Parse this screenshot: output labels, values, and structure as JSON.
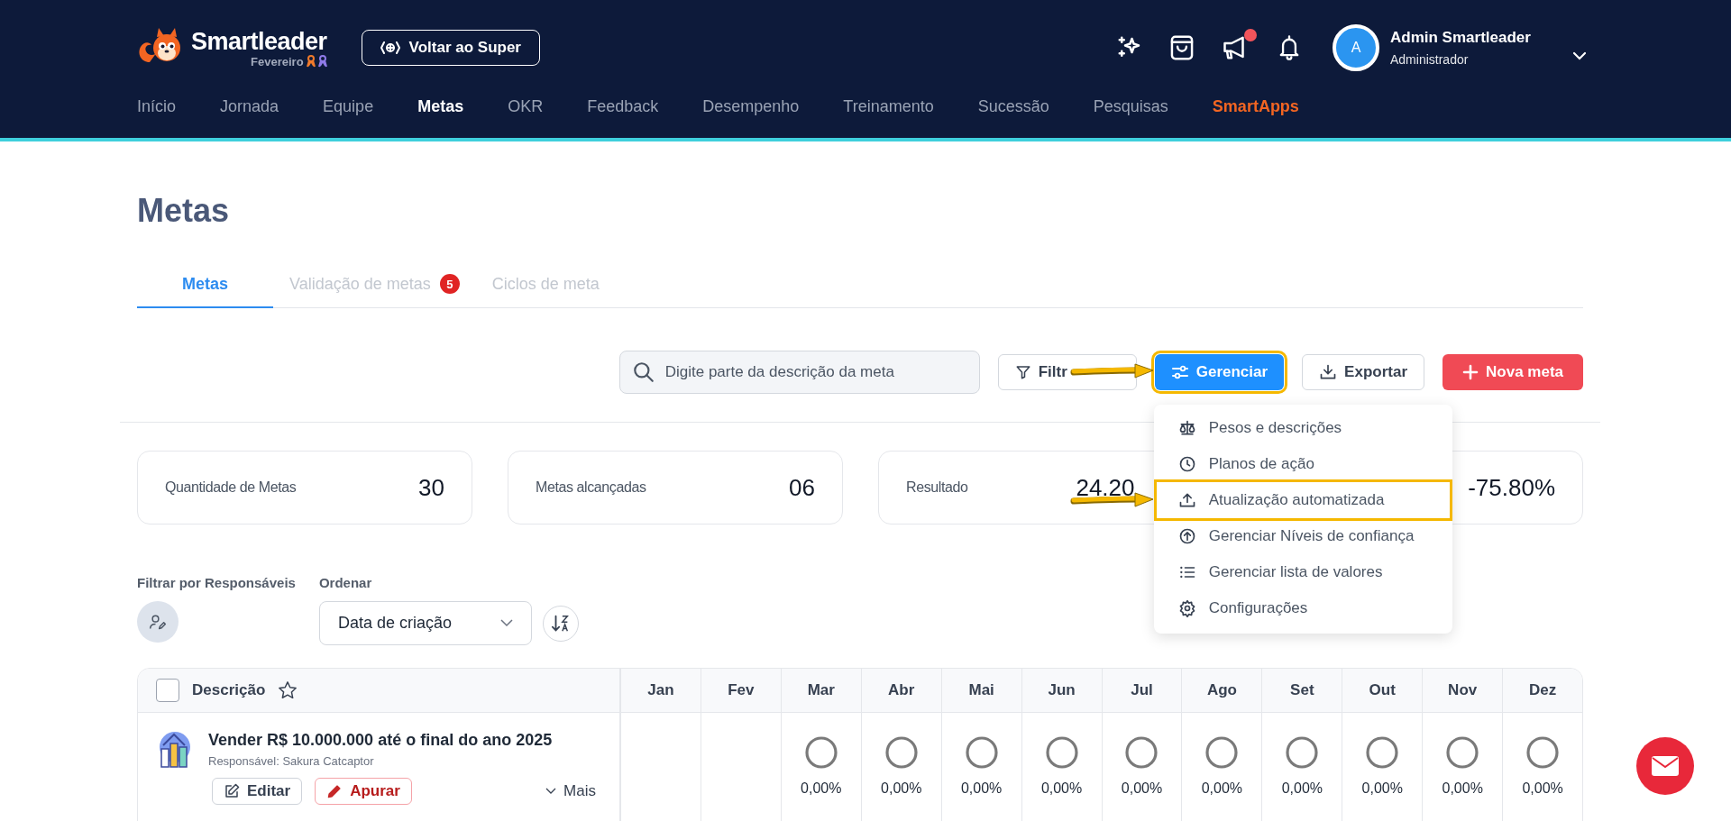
{
  "header": {
    "logo": {
      "name": "Smartleader",
      "subtitle": "Fevereiro"
    },
    "back_button": "Voltar ao Super",
    "megaphone_badge": true,
    "user": {
      "initial": "A",
      "name": "Admin Smartleader",
      "role": "Administrador"
    }
  },
  "nav": [
    {
      "label": "Início",
      "selected": false,
      "kind": "link"
    },
    {
      "label": "Jornada",
      "selected": false,
      "kind": "link"
    },
    {
      "label": "Equipe",
      "selected": false,
      "kind": "link"
    },
    {
      "label": "Metas",
      "selected": true,
      "kind": "link"
    },
    {
      "label": "OKR",
      "selected": false,
      "kind": "link"
    },
    {
      "label": "Feedback",
      "selected": false,
      "kind": "link"
    },
    {
      "label": "Desempenho",
      "selected": false,
      "kind": "link"
    },
    {
      "label": "Treinamento",
      "selected": false,
      "kind": "link"
    },
    {
      "label": "Sucessão",
      "selected": false,
      "kind": "link"
    },
    {
      "label": "Pesquisas",
      "selected": false,
      "kind": "link"
    },
    {
      "label": "SmartApps",
      "selected": false,
      "kind": "highlight"
    }
  ],
  "page_title": "Metas",
  "tabs": [
    {
      "label": "Metas",
      "selected": true
    },
    {
      "label": "Validação de metas",
      "selected": false,
      "badge": "5"
    },
    {
      "label": "Ciclos de meta",
      "selected": false
    }
  ],
  "toolbar": {
    "search": {
      "placeholder": "Digite parte da descrição da meta"
    },
    "filter_button": "Filtr",
    "manage_button": {
      "label": "Gerenciar",
      "highlighted": true
    },
    "export_button": "Exportar",
    "new_button": "Nova meta"
  },
  "manage_menu": [
    {
      "kind": "weights",
      "label": "Pesos e descrições",
      "highlighted": false
    },
    {
      "kind": "clock",
      "label": "Planos de ação",
      "highlighted": false
    },
    {
      "kind": "upload",
      "label": "Atualização automatizada",
      "highlighted": true
    },
    {
      "kind": "up-circle",
      "label": "Gerenciar Níveis de confiança",
      "highlighted": false
    },
    {
      "kind": "list",
      "label": "Gerenciar lista de valores",
      "highlighted": false
    },
    {
      "kind": "gear",
      "label": "Configurações",
      "highlighted": false
    }
  ],
  "stats": [
    {
      "label": "Quantidade de Metas",
      "values": [
        "30"
      ]
    },
    {
      "label": "Metas alcançadas",
      "values": [
        "06"
      ]
    },
    {
      "label": "Resultado",
      "values": [
        "24.20",
        "-75.80%"
      ]
    }
  ],
  "filters": {
    "responsible_label": "Filtrar por Responsáveis",
    "sort_label": "Ordenar",
    "sort_value": "Data de criação"
  },
  "table": {
    "columns": [
      "Descrição",
      "Jan",
      "Fev",
      "Mar",
      "Abr",
      "Mai",
      "Jun",
      "Jul",
      "Ago",
      "Set",
      "Out",
      "Nov",
      "Dez"
    ],
    "select_all": false,
    "rows": [
      {
        "title": "Vender R$ 10.000.000 até o final do ano 2025",
        "owner": "Responsável: Sakura Catcaptor",
        "edit": "Editar",
        "measure": "Apurar",
        "more": "Mais",
        "months": [
          {
            "kind": "empty"
          },
          {
            "kind": "empty"
          },
          {
            "kind": "ring",
            "text": "0,00%"
          },
          {
            "kind": "ring",
            "text": "0,00%"
          },
          {
            "kind": "ring",
            "text": "0,00%"
          },
          {
            "kind": "ring",
            "text": "0,00%"
          },
          {
            "kind": "ring",
            "text": "0,00%"
          },
          {
            "kind": "ring",
            "text": "0,00%"
          },
          {
            "kind": "ring",
            "text": "0,00%"
          },
          {
            "kind": "ring",
            "text": "0,00%"
          },
          {
            "kind": "ring",
            "text": "0,00%"
          },
          {
            "kind": "ring",
            "text": "0,00%"
          }
        ]
      }
    ]
  }
}
